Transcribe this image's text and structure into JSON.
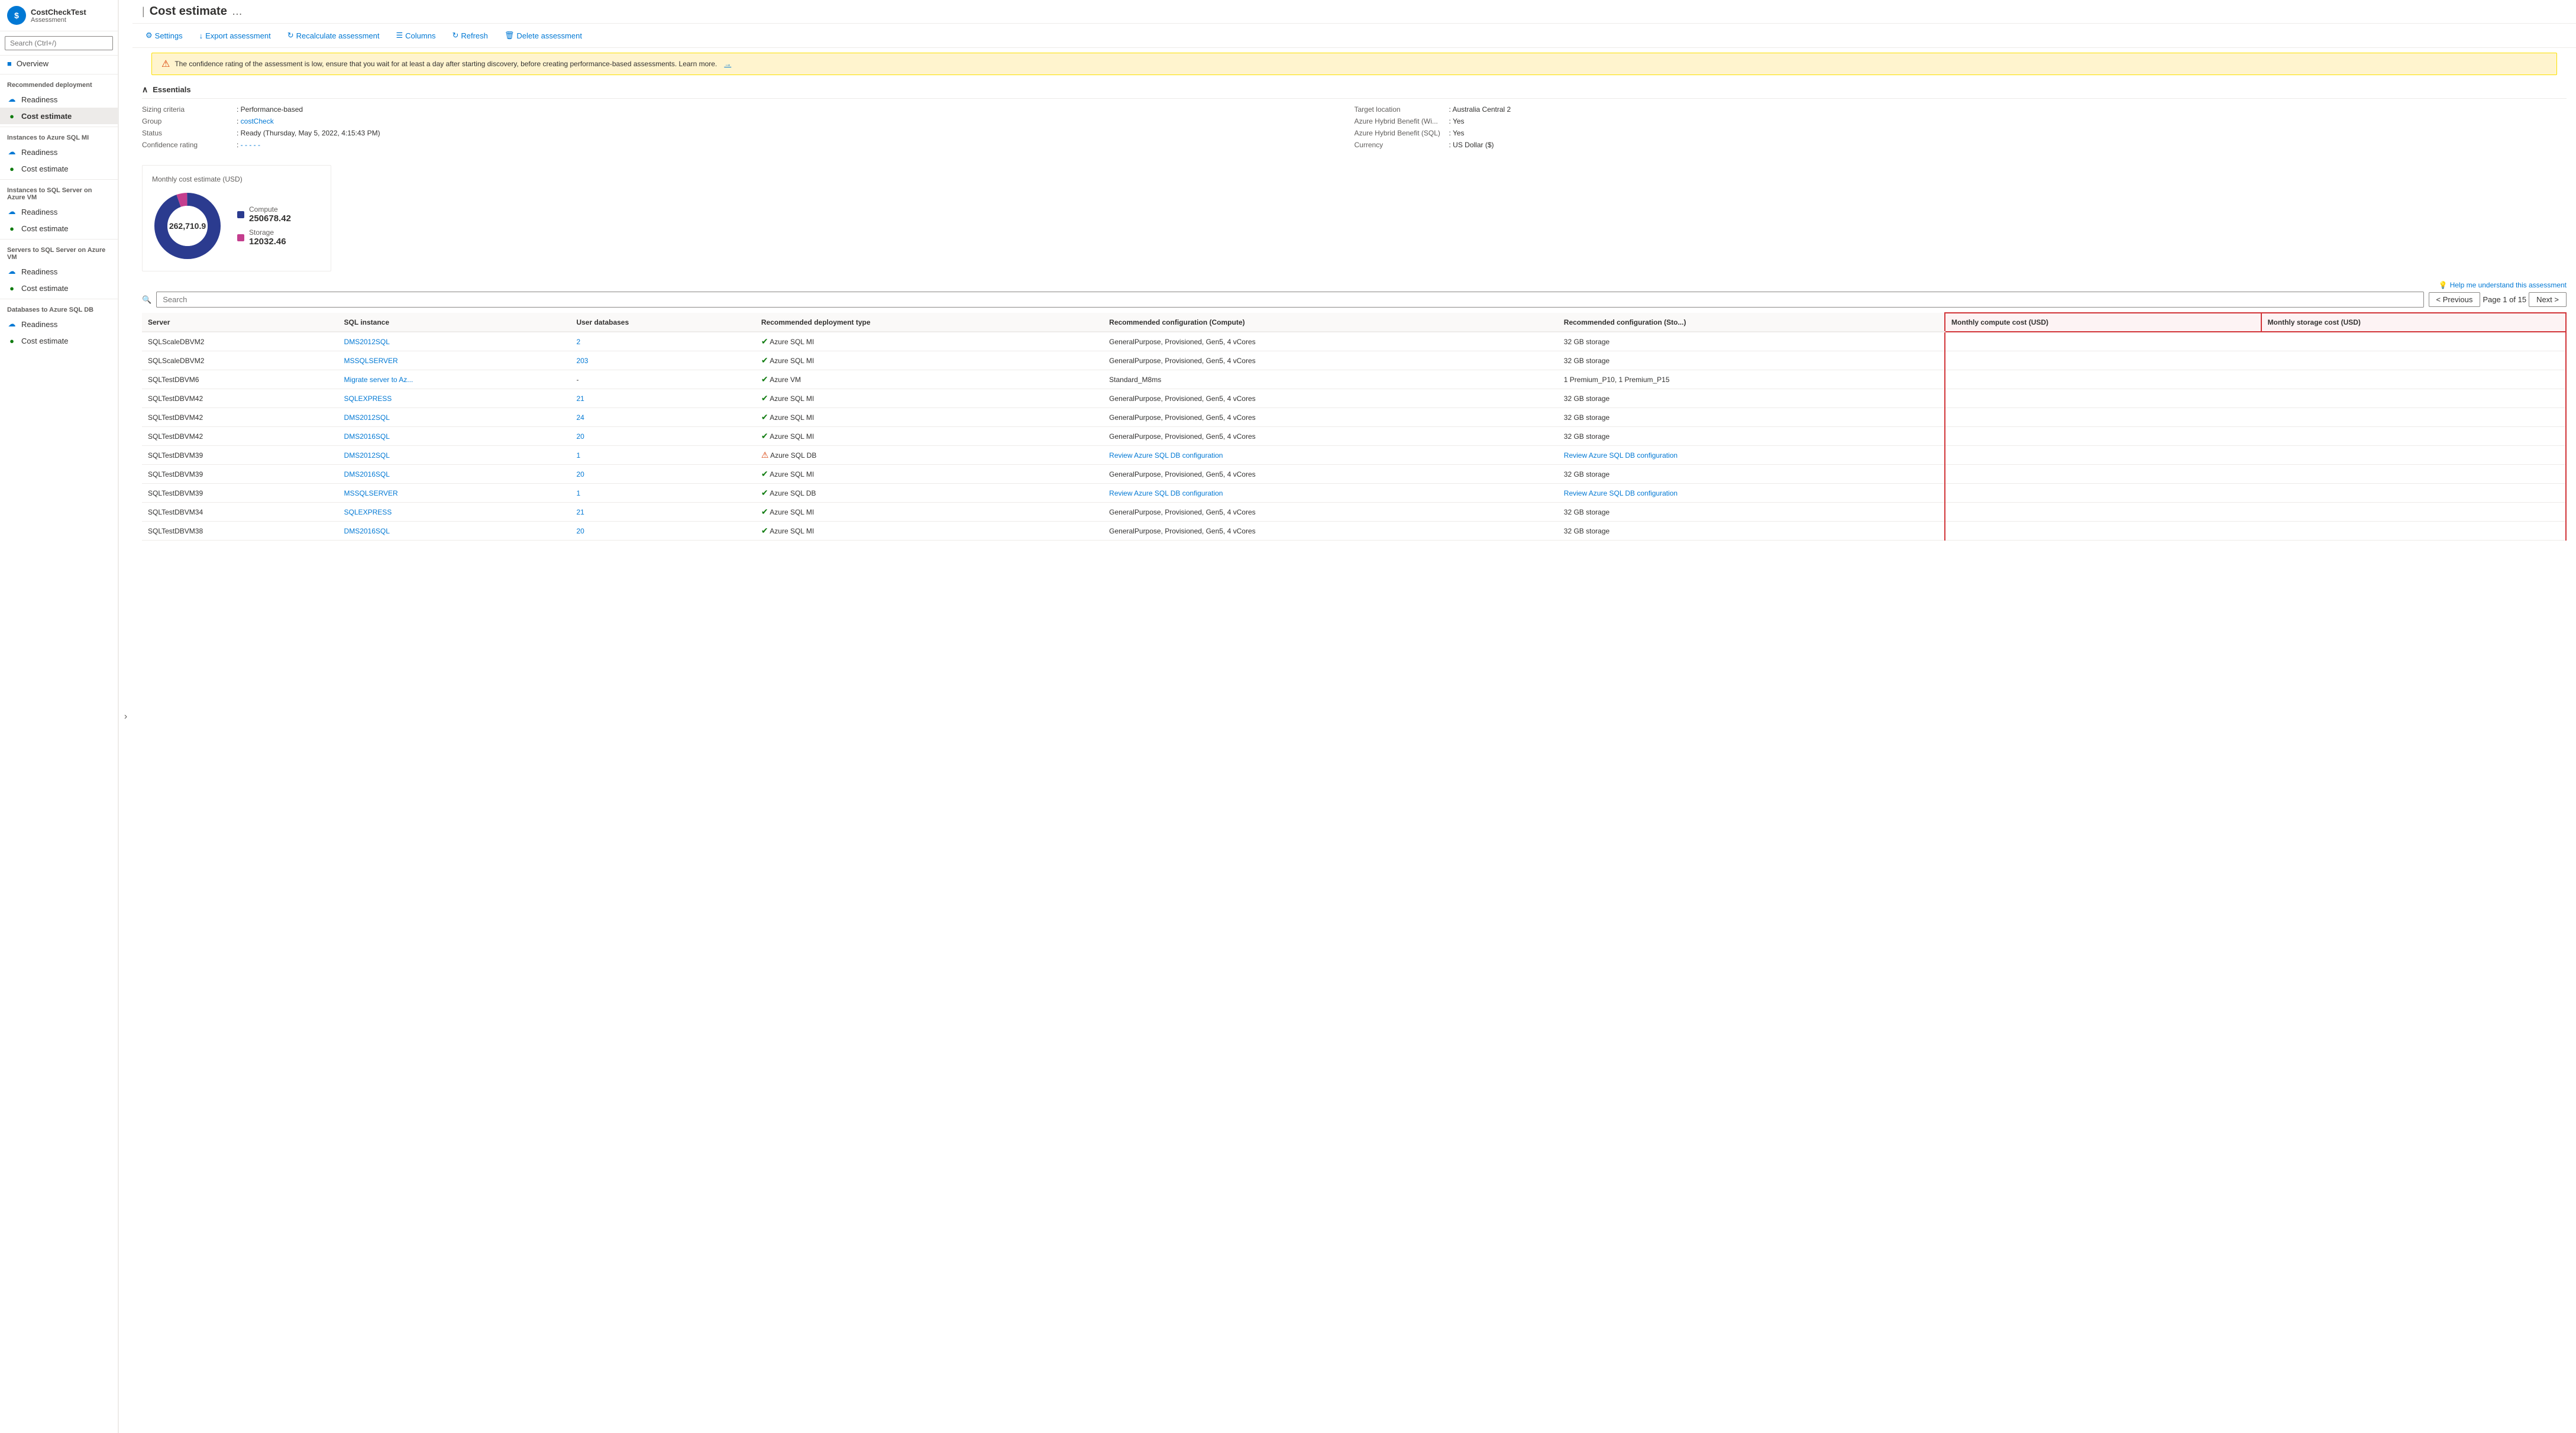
{
  "app": {
    "name": "CostCheckTest",
    "sub": "Assessment",
    "logo_letter": "$"
  },
  "sidebar": {
    "search_placeholder": "Search (Ctrl+/)",
    "overview_label": "Overview",
    "sections": [
      {
        "title": "Recommended deployment",
        "items": [
          {
            "label": "Readiness",
            "icon": "cloud",
            "active": false
          },
          {
            "label": "Cost estimate",
            "icon": "green-circle",
            "active": true
          }
        ]
      },
      {
        "title": "Instances to Azure SQL MI",
        "items": [
          {
            "label": "Readiness",
            "icon": "cloud",
            "active": false
          },
          {
            "label": "Cost estimate",
            "icon": "green-circle",
            "active": false
          }
        ]
      },
      {
        "title": "Instances to SQL Server on Azure VM",
        "items": [
          {
            "label": "Readiness",
            "icon": "cloud",
            "active": false
          },
          {
            "label": "Cost estimate",
            "icon": "green-circle",
            "active": false
          }
        ]
      },
      {
        "title": "Servers to SQL Server on Azure VM",
        "items": [
          {
            "label": "Readiness",
            "icon": "cloud",
            "active": false
          },
          {
            "label": "Cost estimate",
            "icon": "green-circle",
            "active": false
          }
        ]
      },
      {
        "title": "Databases to Azure SQL DB",
        "items": [
          {
            "label": "Readiness",
            "icon": "cloud",
            "active": false
          },
          {
            "label": "Cost estimate",
            "icon": "green-circle",
            "active": false
          }
        ]
      }
    ]
  },
  "header": {
    "title": "Cost estimate",
    "breadcrumb": "|"
  },
  "toolbar": {
    "settings_label": "Settings",
    "export_label": "Export assessment",
    "recalculate_label": "Recalculate assessment",
    "columns_label": "Columns",
    "refresh_label": "Refresh",
    "delete_label": "Delete assessment"
  },
  "warning": {
    "text": "The confidence rating of the assessment is low, ensure that you wait for at least a day after starting discovery, before creating performance-based assessments. Learn more.",
    "arrow": "→"
  },
  "essentials": {
    "title": "Essentials",
    "left": [
      {
        "label": "Sizing criteria",
        "value": "Performance-based",
        "link": false
      },
      {
        "label": "Group",
        "value": "costCheck",
        "link": true
      },
      {
        "label": "Status",
        "value": "Ready (Thursday, May 5, 2022, 4:15:43 PM)",
        "link": false
      },
      {
        "label": "Confidence rating",
        "value": "- - - - -",
        "link": true
      }
    ],
    "right": [
      {
        "label": "Target location",
        "value": "Australia Central 2",
        "link": false
      },
      {
        "label": "Azure Hybrid Benefit (Wi...",
        "value": "Yes",
        "link": false
      },
      {
        "label": "Azure Hybrid Benefit (SQL)",
        "value": "Yes",
        "link": false
      },
      {
        "label": "Currency",
        "value": "US Dollar ($)",
        "link": false
      }
    ]
  },
  "chart": {
    "title": "Monthly cost estimate (USD)",
    "center_value": "262,710.9",
    "compute_label": "Compute",
    "compute_value": "250678.42",
    "storage_label": "Storage",
    "storage_value": "12032.46",
    "compute_color": "#2b3b8f",
    "storage_color": "#c43e8e"
  },
  "table": {
    "search_placeholder": "Search",
    "help_text": "Help me understand this assessment",
    "pagination": {
      "previous": "< Previous",
      "next": "Next >",
      "page_info": "Page 1 of 15"
    },
    "columns": [
      {
        "label": "Server",
        "highlighted": false
      },
      {
        "label": "SQL instance",
        "highlighted": false
      },
      {
        "label": "User databases",
        "highlighted": false
      },
      {
        "label": "Recommended deployment type",
        "highlighted": false
      },
      {
        "label": "Recommended configuration (Compute)",
        "highlighted": false
      },
      {
        "label": "Recommended configuration (Sto...",
        "highlighted": false
      },
      {
        "label": "Monthly compute cost (USD)",
        "highlighted": true
      },
      {
        "label": "Monthly storage cost (USD)",
        "highlighted": true
      }
    ],
    "rows": [
      {
        "server": "SQLScaleDBVM2",
        "sql_instance": "DMS2012SQL",
        "sql_instance_link": true,
        "user_databases": "2",
        "user_databases_link": true,
        "deployment_type": "Azure SQL MI",
        "deployment_status": "green",
        "compute_config": "GeneralPurpose, Provisioned, Gen5, 4 vCores",
        "storage_config": "32 GB storage",
        "monthly_compute": "",
        "monthly_storage": ""
      },
      {
        "server": "SQLScaleDBVM2",
        "sql_instance": "MSSQLSERVER",
        "sql_instance_link": true,
        "user_databases": "203",
        "user_databases_link": true,
        "deployment_type": "Azure SQL MI",
        "deployment_status": "green",
        "compute_config": "GeneralPurpose, Provisioned, Gen5, 4 vCores",
        "storage_config": "32 GB storage",
        "monthly_compute": "",
        "monthly_storage": ""
      },
      {
        "server": "SQLTestDBVM6",
        "sql_instance": "Migrate server to Az...",
        "sql_instance_link": true,
        "user_databases": "-",
        "user_databases_link": false,
        "deployment_type": "Azure VM",
        "deployment_status": "green",
        "compute_config": "Standard_M8ms",
        "storage_config": "1 Premium_P10, 1 Premium_P15",
        "monthly_compute": "",
        "monthly_storage": ""
      },
      {
        "server": "SQLTestDBVM42",
        "sql_instance": "SQLEXPRESS",
        "sql_instance_link": true,
        "user_databases": "21",
        "user_databases_link": true,
        "deployment_type": "Azure SQL MI",
        "deployment_status": "green",
        "compute_config": "GeneralPurpose, Provisioned, Gen5, 4 vCores",
        "storage_config": "32 GB storage",
        "monthly_compute": "",
        "monthly_storage": ""
      },
      {
        "server": "SQLTestDBVM42",
        "sql_instance": "DMS2012SQL",
        "sql_instance_link": true,
        "user_databases": "24",
        "user_databases_link": true,
        "deployment_type": "Azure SQL MI",
        "deployment_status": "green",
        "compute_config": "GeneralPurpose, Provisioned, Gen5, 4 vCores",
        "storage_config": "32 GB storage",
        "monthly_compute": "",
        "monthly_storage": ""
      },
      {
        "server": "SQLTestDBVM42",
        "sql_instance": "DMS2016SQL",
        "sql_instance_link": true,
        "user_databases": "20",
        "user_databases_link": true,
        "deployment_type": "Azure SQL MI",
        "deployment_status": "green",
        "compute_config": "GeneralPurpose, Provisioned, Gen5, 4 vCores",
        "storage_config": "32 GB storage",
        "monthly_compute": "",
        "monthly_storage": ""
      },
      {
        "server": "SQLTestDBVM39",
        "sql_instance": "DMS2012SQL",
        "sql_instance_link": true,
        "user_databases": "1",
        "user_databases_link": true,
        "deployment_type": "Azure SQL DB",
        "deployment_status": "warning",
        "compute_config": "Review Azure SQL DB configuration",
        "compute_config_link": true,
        "storage_config": "Review Azure SQL DB configuration",
        "storage_config_link": true,
        "monthly_compute": "",
        "monthly_storage": ""
      },
      {
        "server": "SQLTestDBVM39",
        "sql_instance": "DMS2016SQL",
        "sql_instance_link": true,
        "user_databases": "20",
        "user_databases_link": true,
        "deployment_type": "Azure SQL MI",
        "deployment_status": "green",
        "compute_config": "GeneralPurpose, Provisioned, Gen5, 4 vCores",
        "storage_config": "32 GB storage",
        "monthly_compute": "",
        "monthly_storage": ""
      },
      {
        "server": "SQLTestDBVM39",
        "sql_instance": "MSSQLSERVER",
        "sql_instance_link": true,
        "user_databases": "1",
        "user_databases_link": true,
        "deployment_type": "Azure SQL DB",
        "deployment_status": "green",
        "compute_config": "Review Azure SQL DB configuration",
        "compute_config_link": true,
        "storage_config": "Review Azure SQL DB configuration",
        "storage_config_link": true,
        "monthly_compute": "",
        "monthly_storage": ""
      },
      {
        "server": "SQLTestDBVM34",
        "sql_instance": "SQLEXPRESS",
        "sql_instance_link": true,
        "user_databases": "21",
        "user_databases_link": true,
        "deployment_type": "Azure SQL MI",
        "deployment_status": "green",
        "compute_config": "GeneralPurpose, Provisioned, Gen5, 4 vCores",
        "storage_config": "32 GB storage",
        "monthly_compute": "",
        "monthly_storage": ""
      },
      {
        "server": "SQLTestDBVM38",
        "sql_instance": "DMS2016SQL",
        "sql_instance_link": true,
        "user_databases": "20",
        "user_databases_link": true,
        "deployment_type": "Azure SQL MI",
        "deployment_status": "green",
        "compute_config": "GeneralPurpose, Provisioned, Gen5, 4 vCores",
        "storage_config": "32 GB storage",
        "monthly_compute": "",
        "monthly_storage": ""
      }
    ]
  }
}
